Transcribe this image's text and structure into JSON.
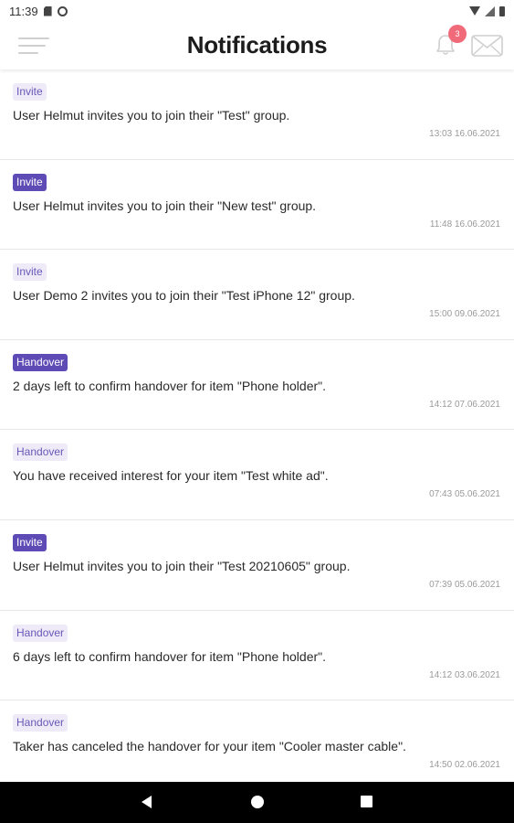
{
  "status_bar": {
    "time": "11:39"
  },
  "header": {
    "title": "Notifications",
    "badge_count": "3"
  },
  "colors": {
    "tag_light_bg": "#efeaf8",
    "tag_dark_bg": "#5e4bb5",
    "badge": "#f06a7a"
  },
  "icons": {
    "menu": "menu-icon",
    "bell": "bell-icon",
    "mail": "mail-icon",
    "back": "back-icon",
    "home": "home-icon",
    "recent": "recent-apps-icon"
  },
  "notifications": [
    {
      "tag": "Invite",
      "tag_style": "light",
      "message": "User Helmut invites you to join their \"Test\" group.",
      "time": "13:03 16.06.2021"
    },
    {
      "tag": "Invite",
      "tag_style": "dark",
      "message": "User Helmut invites you to join their \"New test\" group.",
      "time": "11:48 16.06.2021"
    },
    {
      "tag": "Invite",
      "tag_style": "light",
      "message": "User Demo 2 invites you to join their \"Test iPhone 12\" group.",
      "time": "15:00 09.06.2021"
    },
    {
      "tag": "Handover",
      "tag_style": "dark",
      "message": "2 days left to confirm handover for item \"Phone holder\".",
      "time": "14:12 07.06.2021"
    },
    {
      "tag": "Handover",
      "tag_style": "light",
      "message": "You have received interest for your item \"Test white ad\".",
      "time": "07:43 05.06.2021"
    },
    {
      "tag": "Invite",
      "tag_style": "dark",
      "message": "User Helmut invites you to join their \"Test 20210605\" group.",
      "time": "07:39 05.06.2021"
    },
    {
      "tag": "Handover",
      "tag_style": "light",
      "message": "6 days left to confirm handover for item \"Phone holder\".",
      "time": "14:12 03.06.2021"
    },
    {
      "tag": "Handover",
      "tag_style": "light",
      "message": "Taker has canceled the handover for your item \"Cooler master cable\".",
      "time": "14:50 02.06.2021"
    }
  ]
}
